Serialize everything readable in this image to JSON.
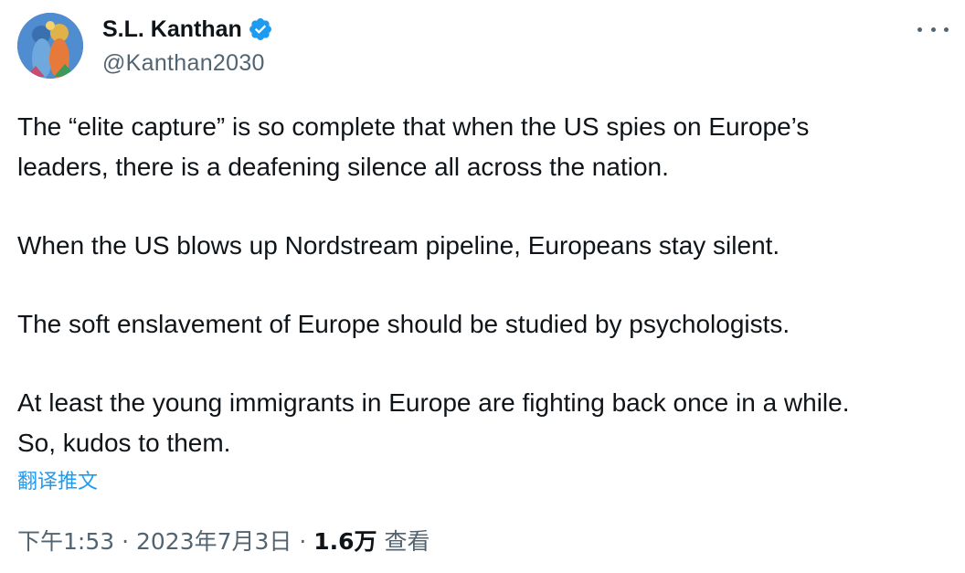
{
  "author": {
    "display_name": "S.L. Kanthan",
    "handle": "@Kanthan2030",
    "verified": true
  },
  "tweet": {
    "paragraphs": [
      [
        "The “elite capture” is so complete that when the US spies on Europe’s",
        "leaders, there is a deafening silence all across the nation."
      ],
      [
        "When the US blows up Nordstream pipeline, Europeans stay silent."
      ],
      [
        "The soft enslavement of Europe should be studied by psychologists."
      ],
      [
        "At least the young immigrants in Europe are fighting back once in a while.",
        "So, kudos to them."
      ]
    ],
    "translate_label": "翻译推文"
  },
  "meta": {
    "time": "下午1:53",
    "separator": " · ",
    "date": "2023年7月3日",
    "views_count": "1.6万",
    "views_label": " 查看"
  },
  "icons": {
    "verified": "verified-badge-icon",
    "more": "more-options-icon"
  },
  "colors": {
    "text_primary": "#0f1419",
    "text_secondary": "#536471",
    "accent": "#1d9bf0"
  }
}
